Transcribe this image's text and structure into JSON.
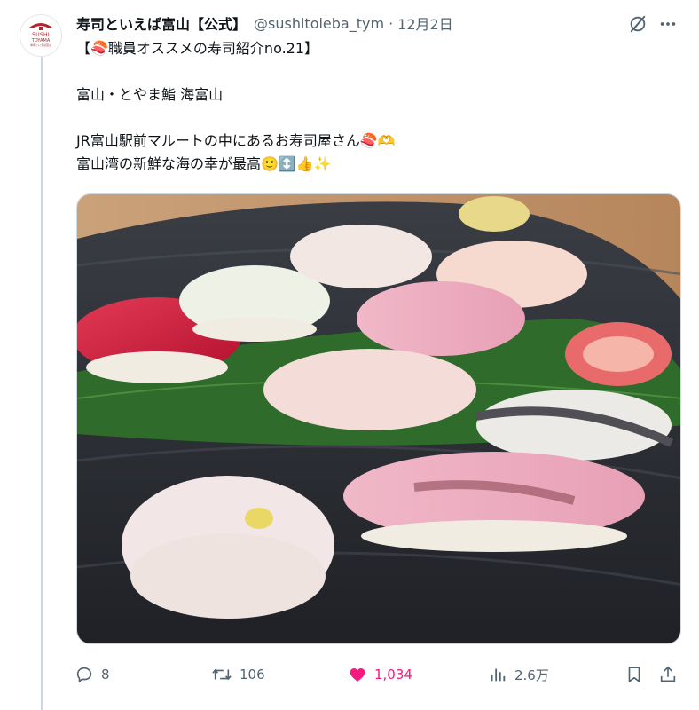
{
  "tweet": {
    "display_name": "寿司といえば富山【公式】",
    "handle": "@sushitoieba_tym",
    "separator": "·",
    "date": "12月2日",
    "avatar_brand": [
      "SUSHI",
      "TOYAMA",
      "寿司といえば富山"
    ],
    "lines": [
      "【🍣職員オススメの寿司紹介no.21】",
      "",
      "富山・とやま鮨 海富山",
      "",
      "JR富山駅前マルートの中にあるお寿司屋さん🍣🫶",
      "富山湾の新鮮な海の幸が最高🙂↕️👍✨"
    ]
  },
  "actions": {
    "reply_count": "8",
    "retweet_count": "106",
    "like_count": "1,034",
    "views_count": "2.6万"
  },
  "icons": {
    "grok": "grok-icon",
    "more": "more-icon",
    "reply": "reply-icon",
    "retweet": "retweet-icon",
    "like": "heart-icon",
    "views": "views-icon",
    "bookmark": "bookmark-icon",
    "share": "share-icon"
  },
  "colors": {
    "text": "#0f1419",
    "secondary": "#536471",
    "like": "#f91880",
    "brand": "#b3262a",
    "thread_line": "#cfd9de"
  }
}
